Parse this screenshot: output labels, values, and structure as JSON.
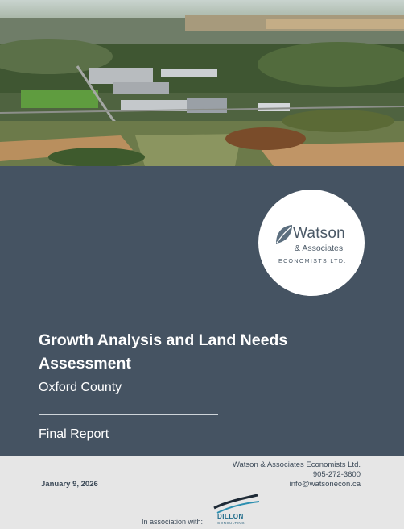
{
  "logo": {
    "name": "Watson",
    "sub": "& Associates",
    "tag": "ECONOMISTS LTD."
  },
  "report": {
    "title": "Growth Analysis and Land Needs Assessment",
    "county": "Oxford County",
    "type": "Final Report"
  },
  "footer": {
    "date": "January 9, 2026",
    "company": "Watson & Associates Economists Ltd.",
    "phone": "905-272-3600",
    "email": "info@watsonecon.ca",
    "association": "In association with:",
    "partner_name": "DILLON",
    "partner_sub": "CONSULTING"
  },
  "colors": {
    "panel": "#455362",
    "footer": "#e6e6e6",
    "text_dark": "#3c4a58"
  }
}
